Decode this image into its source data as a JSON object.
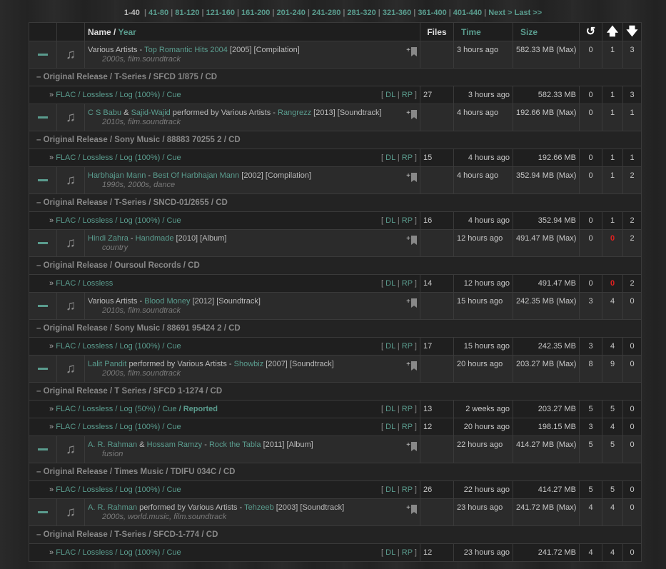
{
  "pager": {
    "current": "1-40",
    "links": [
      "41-80",
      "81-120",
      "121-160",
      "161-200",
      "201-240",
      "241-280",
      "281-320",
      "321-360",
      "361-400",
      "401-440"
    ],
    "next": "Next >",
    "last": "Last >>"
  },
  "header": {
    "name": "Name /",
    "year": "Year",
    "files": "Files",
    "time": "Time",
    "size": "Size",
    "snatch_icon": "↺",
    "seed_icon": "🡅",
    "leech_icon": "🡇"
  },
  "common": {
    "dl": "DL",
    "rp": "RP",
    "bookmark_plus": "+",
    "torrent_prefix": "»"
  },
  "groups": [
    {
      "artist": "Various Artists",
      "joiner": "",
      "artist2": "",
      "performed": "",
      "title": "Top Romantic Hits 2004",
      "info": "[2005] [Compilation]",
      "tags": "2000s, film.soundtrack",
      "time": "3 hours ago",
      "size": "582.33 MB (Max)",
      "snatches": "0",
      "seeders": "1",
      "leechers": "3",
      "edition": "– Original Release / T-Series / SFCD 1/875 / CD",
      "torrents": [
        {
          "format": "FLAC / Lossless / Log (100%) / Cue",
          "reported": "",
          "files": "27",
          "time": "3 hours ago",
          "size": "582.33 MB",
          "snatches": "0",
          "seeders": "1",
          "leechers": "3"
        }
      ]
    },
    {
      "artist": "C S Babu",
      "joiner": "&",
      "artist2": "Sajid-Wajid",
      "performed": "performed by Various Artists -",
      "title": "Rangrezz",
      "info": "[2013] [Soundtrack]",
      "tags": "2010s, film.soundtrack",
      "time": "4 hours ago",
      "size": "192.66 MB (Max)",
      "snatches": "0",
      "seeders": "1",
      "leechers": "1",
      "edition": "– Original Release / Sony Music / 88883 70255 2 / CD",
      "torrents": [
        {
          "format": "FLAC / Lossless / Log (100%) / Cue",
          "reported": "",
          "files": "15",
          "time": "4 hours ago",
          "size": "192.66 MB",
          "snatches": "0",
          "seeders": "1",
          "leechers": "1"
        }
      ]
    },
    {
      "artist": "Harbhajan Mann",
      "joiner": "",
      "artist2": "",
      "performed": "",
      "title": "Best Of Harbhajan Mann",
      "info": "[2002] [Compilation]",
      "tags": "1990s, 2000s, dance",
      "time": "4 hours ago",
      "size": "352.94 MB (Max)",
      "snatches": "0",
      "seeders": "1",
      "leechers": "2",
      "edition": "– Original Release / T-Series / SNCD-01/2655 / CD",
      "torrents": [
        {
          "format": "FLAC / Lossless / Log (100%) / Cue",
          "reported": "",
          "files": "16",
          "time": "4 hours ago",
          "size": "352.94 MB",
          "snatches": "0",
          "seeders": "1",
          "leechers": "2"
        }
      ]
    },
    {
      "artist": "Hindi Zahra",
      "joiner": "",
      "artist2": "",
      "performed": "",
      "title": "Handmade",
      "info": "[2010] [Album]",
      "tags": "country",
      "time": "12 hours ago",
      "size": "491.47 MB (Max)",
      "snatches": "0",
      "seeders": "0",
      "leechers": "2",
      "edition": "– Original Release / Oursoul Records / CD",
      "torrents": [
        {
          "format": "FLAC / Lossless",
          "reported": "",
          "files": "14",
          "time": "12 hours ago",
          "size": "491.47 MB",
          "snatches": "0",
          "seeders": "0",
          "leechers": "2"
        }
      ]
    },
    {
      "artist": "Various Artists",
      "joiner": "",
      "artist2": "",
      "performed": "",
      "title": "Blood Money",
      "info": "[2012] [Soundtrack]",
      "tags": "2010s, film.soundtrack",
      "time": "15 hours ago",
      "size": "242.35 MB (Max)",
      "snatches": "3",
      "seeders": "4",
      "leechers": "0",
      "edition": "– Original Release / Sony Music / 88691 95424 2 / CD",
      "torrents": [
        {
          "format": "FLAC / Lossless / Log (100%) / Cue",
          "reported": "",
          "files": "17",
          "time": "15 hours ago",
          "size": "242.35 MB",
          "snatches": "3",
          "seeders": "4",
          "leechers": "0"
        }
      ]
    },
    {
      "artist": "Lalit Pandit",
      "joiner": "",
      "artist2": "",
      "performed": "performed by Various Artists -",
      "title": "Showbiz",
      "info": "[2007] [Soundtrack]",
      "tags": "2000s, film.soundtrack",
      "time": "20 hours ago",
      "size": "203.27 MB (Max)",
      "snatches": "8",
      "seeders": "9",
      "leechers": "0",
      "edition": "– Original Release / T Series / SFCD 1-1274 / CD",
      "torrents": [
        {
          "format": "FLAC / Lossless / Log (50%) / Cue",
          "reported": "/ Reported",
          "files": "13",
          "time": "2 weeks ago",
          "size": "203.27 MB",
          "snatches": "5",
          "seeders": "5",
          "leechers": "0"
        },
        {
          "format": "FLAC / Lossless / Log (100%) / Cue",
          "reported": "",
          "files": "12",
          "time": "20 hours ago",
          "size": "198.15 MB",
          "snatches": "3",
          "seeders": "4",
          "leechers": "0"
        }
      ]
    },
    {
      "artist": "A. R. Rahman",
      "joiner": "&",
      "artist2": "Hossam Ramzy",
      "performed": "-",
      "title": "Rock the Tabla",
      "info": "[2011] [Album]",
      "tags": "fusion",
      "time": "22 hours ago",
      "size": "414.27 MB (Max)",
      "snatches": "5",
      "seeders": "5",
      "leechers": "0",
      "edition": "– Original Release / Times Music / TDIFU 034C / CD",
      "torrents": [
        {
          "format": "FLAC / Lossless / Log (100%) / Cue",
          "reported": "",
          "files": "26",
          "time": "22 hours ago",
          "size": "414.27 MB",
          "snatches": "5",
          "seeders": "5",
          "leechers": "0"
        }
      ]
    },
    {
      "artist": "A. R. Rahman",
      "joiner": "",
      "artist2": "",
      "performed": "performed by Various Artists -",
      "title": "Tehzeeb",
      "info": "[2003] [Soundtrack]",
      "tags": "2000s, world.music, film.soundtrack",
      "time": "23 hours ago",
      "size": "241.72 MB (Max)",
      "snatches": "4",
      "seeders": "4",
      "leechers": "0",
      "edition": "– Original Release / T-Series / SFCD-1-774 / CD",
      "torrents": [
        {
          "format": "FLAC / Lossless / Log (100%) / Cue",
          "reported": "",
          "files": "12",
          "time": "23 hours ago",
          "size": "241.72 MB",
          "snatches": "4",
          "seeders": "4",
          "leechers": "0"
        }
      ]
    }
  ]
}
